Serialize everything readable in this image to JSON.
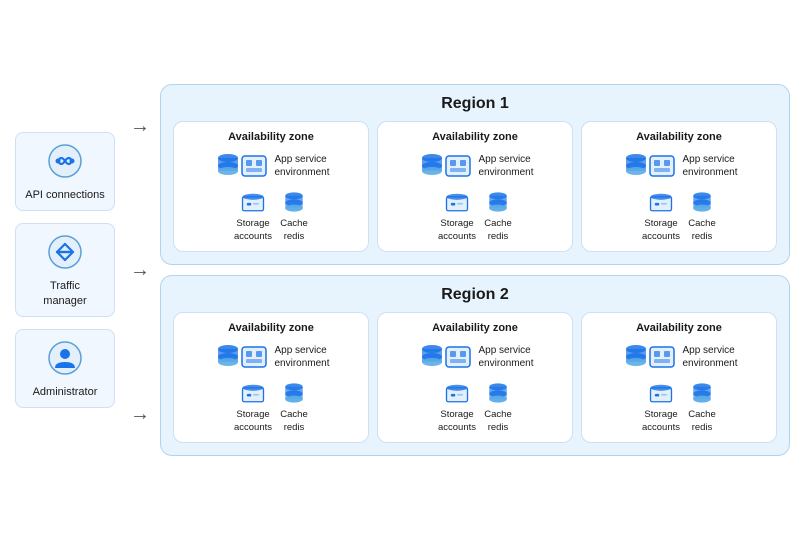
{
  "actors": [
    {
      "id": "api",
      "label": "API\nconnections",
      "icon": "api"
    },
    {
      "id": "traffic",
      "label": "Traffic\nmanager",
      "icon": "traffic"
    },
    {
      "id": "admin",
      "label": "Administrator",
      "icon": "admin"
    }
  ],
  "regions": [
    {
      "id": "region1",
      "title": "Region 1",
      "zones": [
        {
          "title": "Availability zone",
          "service": "App service\nenvironment"
        },
        {
          "title": "Availability zone",
          "service": "App service\nenvironment"
        },
        {
          "title": "Availability zone",
          "service": "App service\nenvironment"
        }
      ]
    },
    {
      "id": "region2",
      "title": "Region 2",
      "zones": [
        {
          "title": "Availability zone",
          "service": "App service\nenvironment"
        },
        {
          "title": "Availability zone",
          "service": "App service\nenvironment"
        },
        {
          "title": "Availability zone",
          "service": "App service\nenvironment"
        }
      ]
    }
  ],
  "service_labels": {
    "storage": "Storage\naccounts",
    "cache": "Cache\nredis",
    "app_service": "App service\nenvironment"
  }
}
